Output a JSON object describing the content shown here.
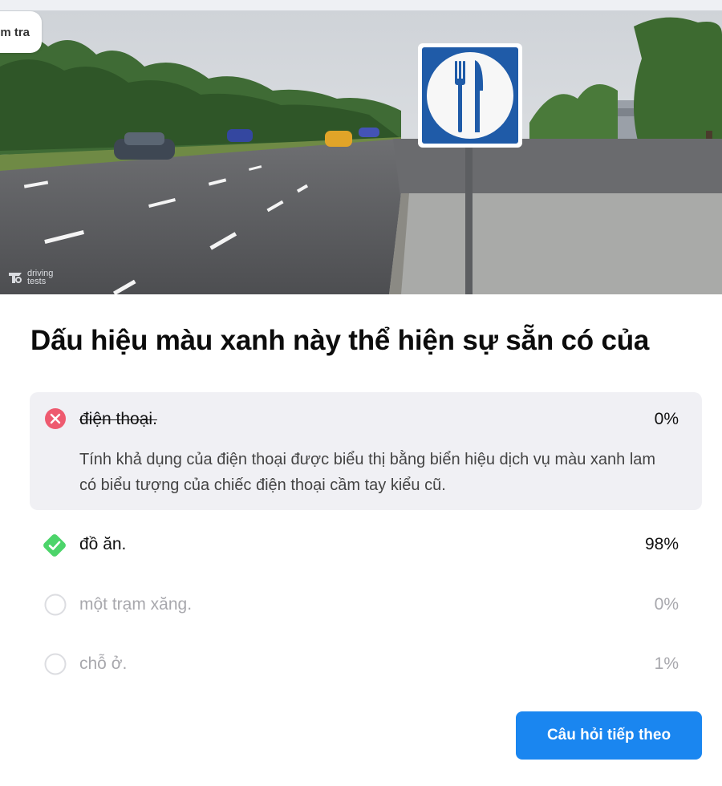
{
  "nav": {
    "back_label": "m tra"
  },
  "hero": {
    "sign_icon": "fork-knife-icon",
    "watermark_line1": "driving",
    "watermark_line2": "tests"
  },
  "question": {
    "text": "Dấu hiệu màu xanh này thể hiện sự sẵn có của"
  },
  "answers": [
    {
      "label": "điện thoại.",
      "percent": "0%",
      "state": "wrong",
      "icon": "x-circle-icon",
      "explanation": "Tính khả dụng của điện thoại được biểu thị bằng biển hiệu dịch vụ màu xanh lam có biểu tượng của chiếc điện thoại cầm tay kiểu cũ."
    },
    {
      "label": "đồ ăn.",
      "percent": "98%",
      "state": "correct",
      "icon": "check-diamond-icon"
    },
    {
      "label": "một trạm xăng.",
      "percent": "0%",
      "state": "unselected",
      "icon": "empty-circle-icon"
    },
    {
      "label": "chỗ ở.",
      "percent": "1%",
      "state": "unselected",
      "icon": "empty-circle-icon"
    }
  ],
  "actions": {
    "next_label": "Câu hỏi tiếp theo"
  },
  "colors": {
    "accent": "#1a86f0",
    "wrong": "#ee5a6f",
    "correct": "#4cd46a",
    "wrong_panel": "#f0f0f4",
    "sign_blue": "#1f5ba8"
  }
}
